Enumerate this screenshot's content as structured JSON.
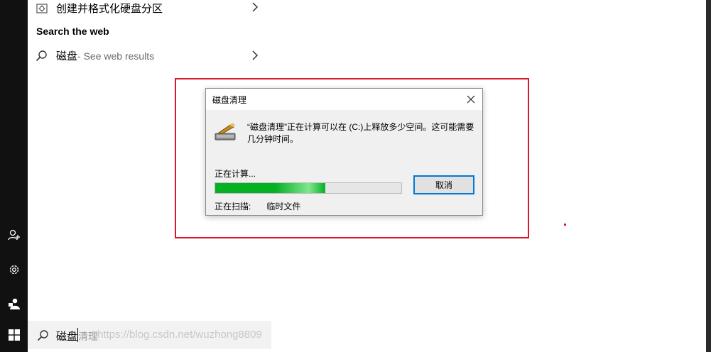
{
  "results": {
    "top_item_label": "创建并格式化硬盘分区",
    "section_title": "Search the web",
    "web_item_label": "磁盘",
    "web_item_sub": " - See web results"
  },
  "dialog": {
    "title": "磁盘清理",
    "message": "“磁盘清理”正在计算可以在 (C:)上释放多少空间。这可能需要几分钟时间。",
    "status": "正在计算...",
    "progress_percent": 59,
    "cancel_label": "取消",
    "scan_label": "正在扫描:",
    "scan_value": "临时文件"
  },
  "search": {
    "typed_text": "磁盘",
    "suggestion_text": "清理",
    "watermark": "https://blog.csdn.net/wuzhong8809"
  },
  "colors": {
    "highlight_border": "#d9182b",
    "progress_green": "#06b025",
    "button_focus": "#0078d7"
  },
  "icons": [
    "settings-app-icon",
    "chevron-right-icon",
    "search-icon",
    "close-icon",
    "disk-cleanup-icon",
    "add-user-icon",
    "gear-icon",
    "user-switch-icon",
    "windows-start-icon"
  ]
}
